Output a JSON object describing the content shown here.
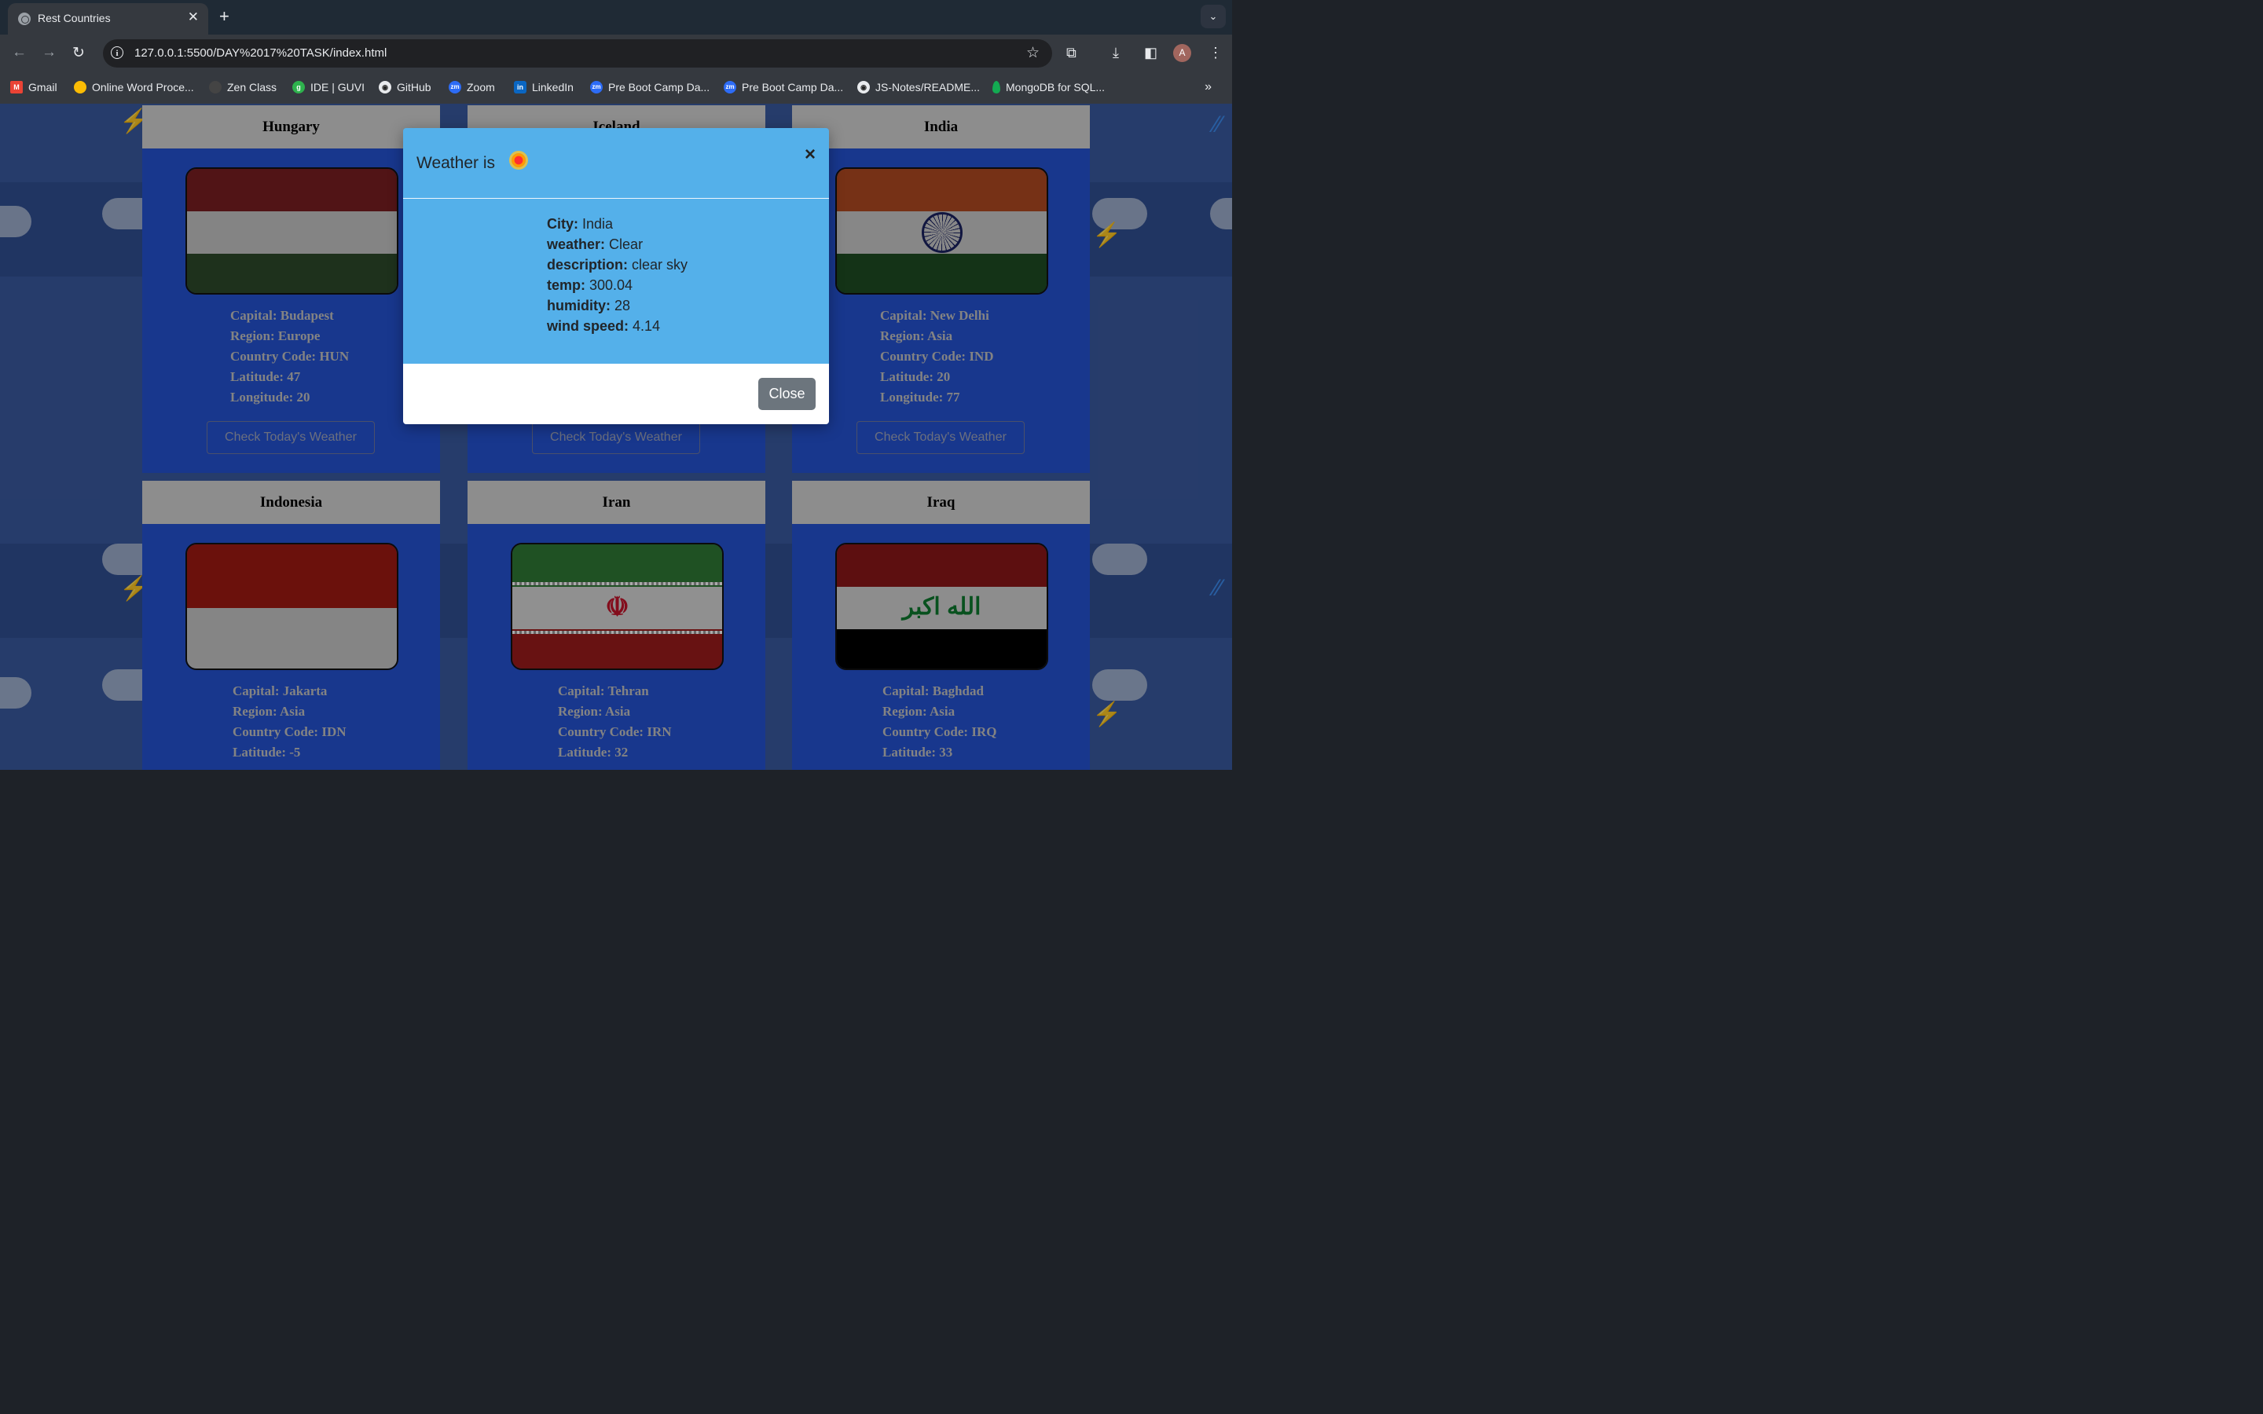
{
  "browser": {
    "tab_title": "Rest Countries",
    "url": "127.0.0.1:5500/DAY%2017%20TASK/index.html",
    "avatar_letter": "A",
    "bookmarks": [
      {
        "label": "Gmail"
      },
      {
        "label": "Online Word Proce..."
      },
      {
        "label": "Zen Class"
      },
      {
        "label": "IDE | GUVI"
      },
      {
        "label": "GitHub"
      },
      {
        "label": "Zoom"
      },
      {
        "label": "LinkedIn"
      },
      {
        "label": "Pre Boot Camp Da..."
      },
      {
        "label": "Pre Boot Camp Da..."
      },
      {
        "label": "JS-Notes/README..."
      },
      {
        "label": "MongoDB for SQL..."
      }
    ]
  },
  "countries": [
    {
      "name": "Hungary",
      "capital": "Capital: Budapest",
      "region": "Region: Europe",
      "code": "Country Code: HUN",
      "lat": "Latitude: 47",
      "lng": "Longitude: 20",
      "button": "Check Today's Weather"
    },
    {
      "name": "Iceland",
      "capital": "",
      "region": "",
      "code": "",
      "lat": "",
      "lng": "",
      "button": "Check Today's Weather"
    },
    {
      "name": "India",
      "capital": "Capital: New Delhi",
      "region": "Region: Asia",
      "code": "Country Code: IND",
      "lat": "Latitude: 20",
      "lng": "Longitude: 77",
      "button": "Check Today's Weather"
    },
    {
      "name": "Indonesia",
      "capital": "Capital: Jakarta",
      "region": "Region: Asia",
      "code": "Country Code: IDN",
      "lat": "Latitude: -5"
    },
    {
      "name": "Iran",
      "capital": "Capital: Tehran",
      "region": "Region: Asia",
      "code": "Country Code: IRN",
      "lat": "Latitude: 32"
    },
    {
      "name": "Iraq",
      "capital": "Capital: Baghdad",
      "region": "Region: Asia",
      "code": "Country Code: IRQ",
      "lat": "Latitude: 33",
      "flag_text": "الله اكبر"
    }
  ],
  "modal": {
    "title": "Weather is",
    "close_symbol": "×",
    "rows": [
      {
        "label": "City:",
        "value": "India"
      },
      {
        "label": "weather:",
        "value": "Clear"
      },
      {
        "label": "description:",
        "value": "clear sky"
      },
      {
        "label": "temp:",
        "value": "300.04"
      },
      {
        "label": "humidity:",
        "value": "28"
      },
      {
        "label": "wind speed:",
        "value": "4.14"
      }
    ],
    "close_button": "Close"
  },
  "colors": {
    "modal_header": "#54b0ea",
    "card_body": "#2553d3",
    "close_button": "#6c757d"
  }
}
